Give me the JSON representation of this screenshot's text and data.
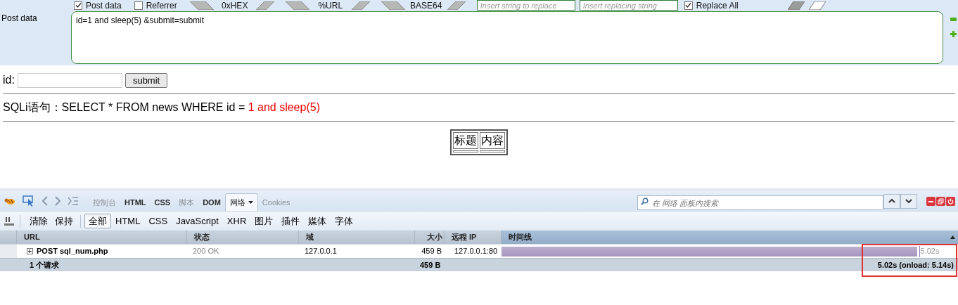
{
  "hackbar": {
    "options": [
      {
        "label": "Post data",
        "checked": true
      },
      {
        "label": "Referrer",
        "checked": false
      }
    ],
    "encoders": [
      "0xHEX",
      "%URL",
      "BASE64"
    ],
    "replace_fields": [
      {
        "placeholder": "Insert string to replace"
      },
      {
        "placeholder": "Insert replacing string"
      }
    ],
    "replace_all": {
      "label": "Replace All",
      "checked": true
    },
    "post_data": {
      "label": "Post data",
      "value": "id=1 and sleep(5) &submit=submit"
    }
  },
  "page": {
    "form": {
      "label": "id:",
      "button": "submit"
    },
    "sql_line": {
      "text": "SQLi语句：SELECT * FROM news WHERE id = ",
      "injected": "1 and sleep(5)"
    },
    "table": {
      "columns": [
        "标题",
        "内容"
      ]
    }
  },
  "devtools": {
    "tabs": [
      {
        "label": "控制台",
        "selected": false,
        "disabled": true
      },
      {
        "label": "HTML",
        "selected": false,
        "disabled": false
      },
      {
        "label": "CSS",
        "selected": false,
        "disabled": false
      },
      {
        "label": "脚本",
        "selected": false,
        "disabled": true
      },
      {
        "label": "DOM",
        "selected": false,
        "disabled": false
      },
      {
        "label": "网络",
        "selected": true,
        "disabled": false
      },
      {
        "label": "Cookies",
        "selected": false,
        "disabled": true
      }
    ],
    "search": {
      "placeholder": "在 网络 面板内搜索"
    },
    "actions": [
      "清除",
      "保持"
    ],
    "filters": [
      {
        "label": "全部",
        "selected": true
      },
      {
        "label": "HTML",
        "selected": false
      },
      {
        "label": "CSS",
        "selected": false
      },
      {
        "label": "JavaScript",
        "selected": false
      },
      {
        "label": "XHR",
        "selected": false
      },
      {
        "label": "图片",
        "selected": false
      },
      {
        "label": "插件",
        "selected": false
      },
      {
        "label": "媒体",
        "selected": false
      },
      {
        "label": "字体",
        "selected": false
      }
    ],
    "columns": [
      "URL",
      "状态",
      "域",
      "大小",
      "远程 IP",
      "时间线"
    ],
    "rows": [
      {
        "url": "POST sql_num.php",
        "status": "200 OK",
        "domain": "127.0.0.1",
        "size": "459 B",
        "remote_ip": "127.0.0.1:80",
        "timeline": {
          "level": 0.91,
          "label": "5.02s"
        }
      }
    ],
    "summary": {
      "count": "1 个请求",
      "size": "459 B",
      "time": "5.02s (onload: 5.14s)"
    }
  }
}
